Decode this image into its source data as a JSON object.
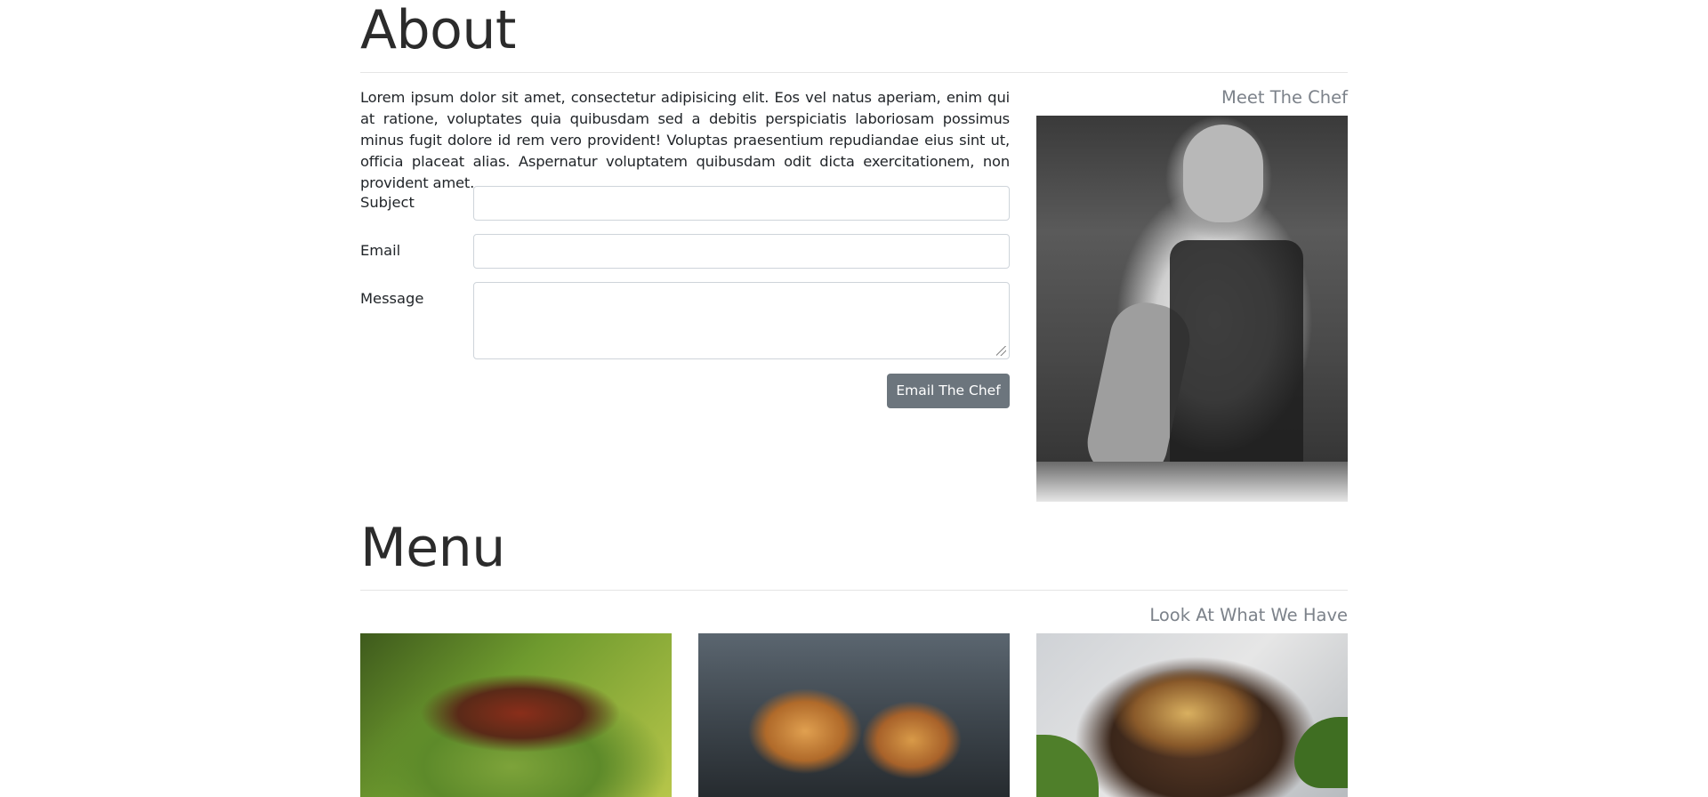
{
  "about": {
    "heading": "About",
    "intro": "Lorem ipsum dolor sit amet, consectetur adipisicing elit. Eos vel natus aperiam, enim qui at ratione, voluptates quia quibusdam sed a debitis perspiciatis laboriosam possimus minus fugit dolore id rem vero provident! Voluptas praesentium repudiandae eius sint ut, officia placeat alias. Aspernatur voluptatem quibusdam odit dicta exercitationem, non provident amet.",
    "subtitle": "Meet The Chef",
    "form": {
      "subject_label": "Subject",
      "subject_value": "",
      "email_label": "Email",
      "email_value": "",
      "message_label": "Message",
      "message_value": "",
      "submit_label": "Email The Chef"
    }
  },
  "menu": {
    "heading": "Menu",
    "subtitle": "Look At What We Have"
  }
}
